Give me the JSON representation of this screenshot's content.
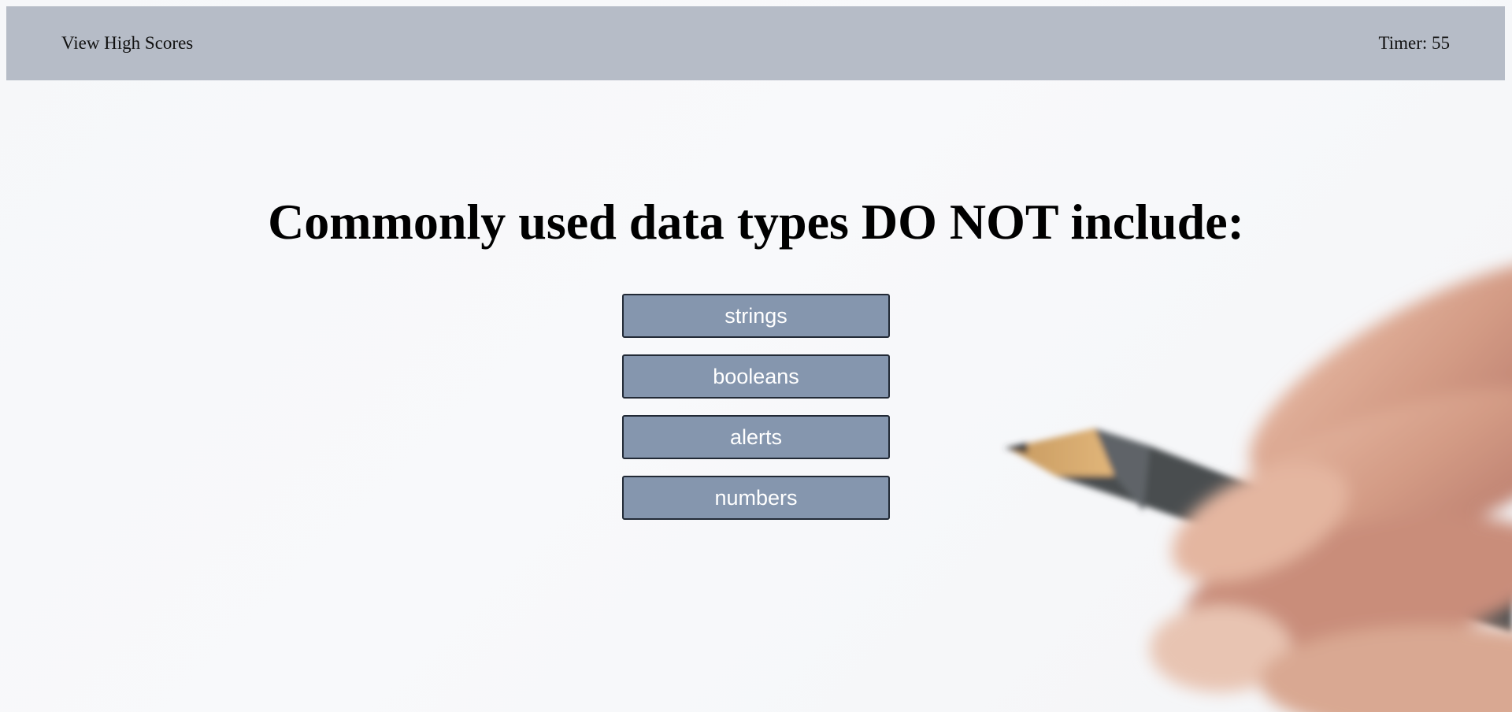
{
  "header": {
    "high_scores_label": "View High Scores",
    "timer_label": "Timer:",
    "timer_value": "55"
  },
  "question": {
    "text": "Commonly used data types DO NOT include:"
  },
  "choices": [
    {
      "label": "strings"
    },
    {
      "label": "booleans"
    },
    {
      "label": "alerts"
    },
    {
      "label": "numbers"
    }
  ],
  "colors": {
    "header_bg": "#b6bcc7",
    "button_bg": "#8596ae",
    "button_border": "#222a36",
    "page_bg": "#f6f7f9"
  },
  "background_image": {
    "icon": "hand-holding-pencil-image"
  }
}
